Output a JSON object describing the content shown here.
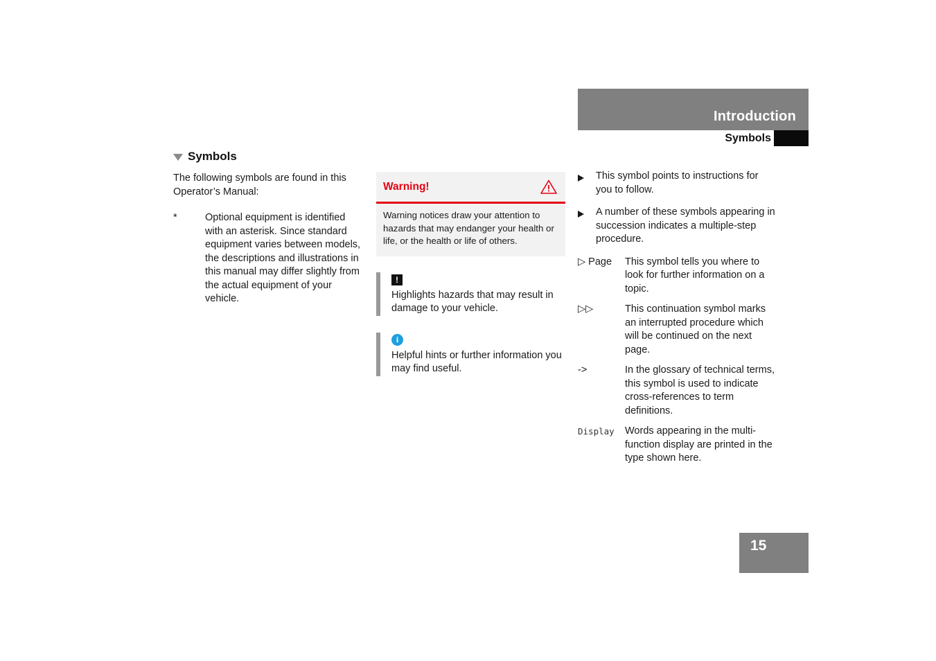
{
  "header": {
    "title": "Introduction",
    "subtitle": "Symbols"
  },
  "column1": {
    "heading": "Symbols",
    "intro": "The following symbols are found in this Operator’s Manual:",
    "asterisk_mark": "*",
    "asterisk_text": "Optional equipment is identified with an asterisk. Since standard equipment varies between models, the descriptions and illustrations in this manual may differ slightly from the actual equipment of your vehicle."
  },
  "column2": {
    "warning": {
      "title": "Warning!",
      "body": "Warning notices draw your attention to hazards that may endanger your health or life, or the health or life of others.",
      "icon": "warning-triangle-icon",
      "accent_color": "#e60012",
      "background_color": "#f2f2f2"
    },
    "notices": [
      {
        "icon": "exclamation-box-icon",
        "text": "Highlights hazards that may result in damage to your vehicle."
      },
      {
        "icon": "info-circle-icon",
        "text": "Helpful hints or further information you may find useful."
      }
    ],
    "exclaim_glyph": "!",
    "info_glyph": "i"
  },
  "column3": {
    "bullets": [
      "This symbol points to instructions for you to follow.",
      "A number of these symbols appearing in succession indicates a multiple-step procedure."
    ],
    "definitions": [
      {
        "term": "▷ Page",
        "mono": false,
        "desc": "This symbol tells you where to look for further information on a topic."
      },
      {
        "term": "▷▷",
        "mono": false,
        "desc": "This continuation symbol marks an interrupted procedure which will be continued on the next page."
      },
      {
        "term": "->",
        "mono": false,
        "desc": "In the glossary of technical terms, this symbol is used to indicate cross-references to term definitions."
      },
      {
        "term": "Display",
        "mono": true,
        "desc": "Words appearing in the multi-function display are printed in the type shown here."
      }
    ]
  },
  "footer": {
    "page_number": "15"
  }
}
